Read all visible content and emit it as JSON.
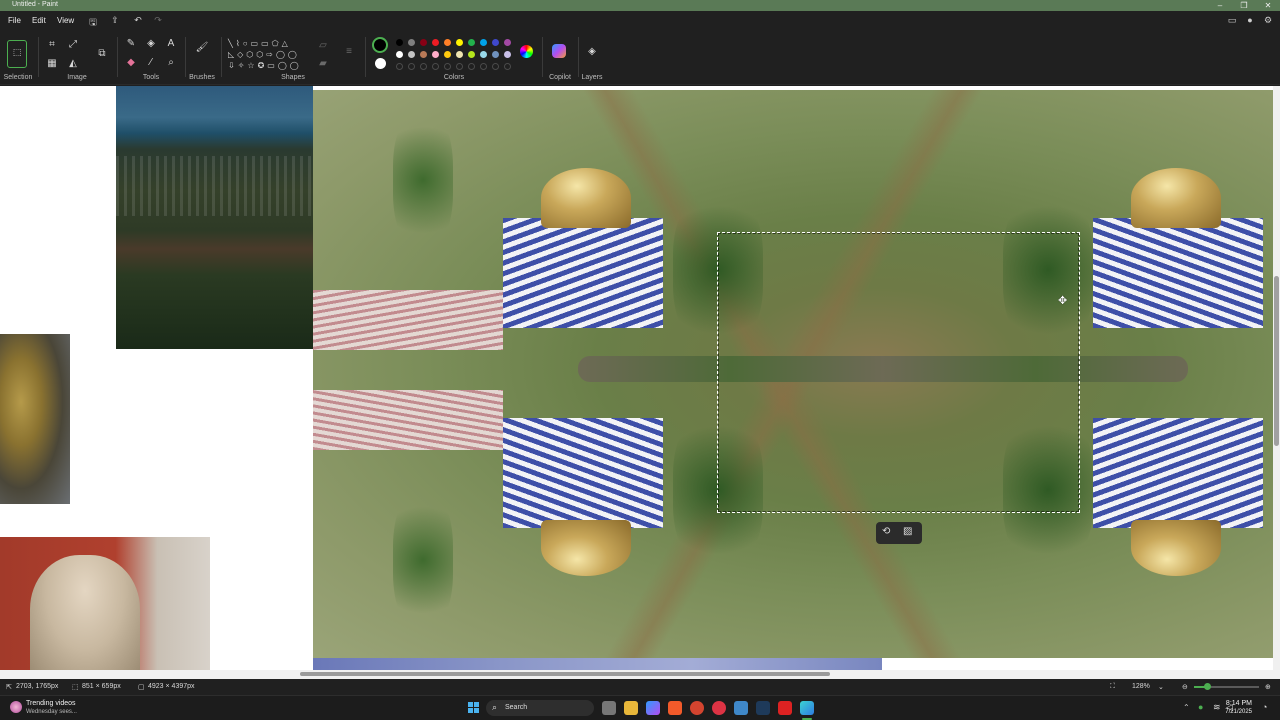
{
  "window": {
    "title": "Untitled - Paint"
  },
  "menu": {
    "file": "File",
    "edit": "Edit",
    "view": "View"
  },
  "ribbon": {
    "groups": {
      "selection": "Selection",
      "image": "Image",
      "tools": "Tools",
      "brushes": "Brushes",
      "shapes": "Shapes",
      "colors": "Colors",
      "copilot": "Copilot",
      "layers": "Layers"
    },
    "palette_row1": [
      "#000000",
      "#7f7f7f",
      "#880015",
      "#ed1c24",
      "#ff7f27",
      "#fff200",
      "#22b14c",
      "#00a2e8",
      "#3f48cc",
      "#a349a4"
    ],
    "palette_row2": [
      "#ffffff",
      "#c3c3c3",
      "#b97a57",
      "#ffaec9",
      "#ffc90e",
      "#efe4b0",
      "#b5e61d",
      "#99d9ea",
      "#7092be",
      "#c8bfe7"
    ],
    "primary_color": "#000000",
    "secondary_color": "#ffffff"
  },
  "status": {
    "cursor_pos": "2703, 1765px",
    "selection_size": "851 × 659px",
    "canvas_size": "4923 × 4397px",
    "zoom": "128%"
  },
  "taskbar": {
    "widget_title": "Trending videos",
    "widget_sub": "Wednesday sees...",
    "search_placeholder": "Search",
    "time": "8:14 PM",
    "date": "7/21/2025"
  }
}
